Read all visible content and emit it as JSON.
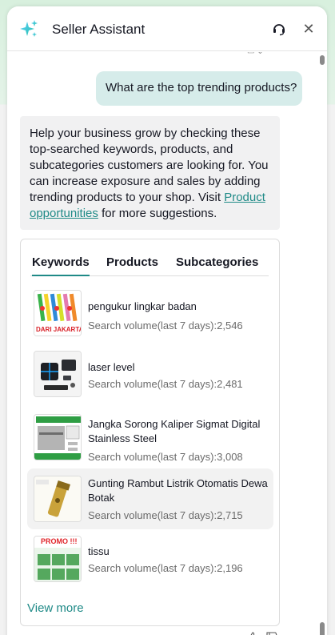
{
  "header": {
    "title": "Seller Assistant",
    "accent": "#2fb8b0"
  },
  "conversation": {
    "user_message": "What are the top trending products?",
    "bot_message_part1": "Help your business grow by checking these top-searched keywords, products, and subcategories customers are looking for. You can increase exposure and sales by adding trending products to your shop. Visit ",
    "bot_link": "Product opportunities",
    "bot_message_part2": " for more suggestions."
  },
  "card": {
    "tabs": [
      {
        "label": "Keywords",
        "active": true
      },
      {
        "label": "Products",
        "active": false
      },
      {
        "label": "Subcategories",
        "active": false
      }
    ],
    "items": [
      {
        "name": "pengukur lingkar badan",
        "volume": "Search volume(last 7 days):2,546",
        "thumb_text": "DARI JAKARTA"
      },
      {
        "name": "laser level",
        "volume": "Search volume(last 7 days):2,481"
      },
      {
        "name": "Jangka Sorong Kaliper Sigmat Digital Stainless Steel",
        "volume": "Search volume(last 7 days):3,008"
      },
      {
        "name": "Gunting Rambut Listrik Otomatis Dewa Botak",
        "volume": "Search volume(last 7 days):2,715"
      },
      {
        "name": "tissu",
        "volume": "Search volume(last 7 days):2,196",
        "thumb_text": "PROMO !!!"
      }
    ],
    "view_more": "View more"
  },
  "icons": {
    "sparkle": "sparkle-icon",
    "headset": "headset-icon",
    "close": "close-icon",
    "thumbs_up": "thumbs-up-icon",
    "thumbs_down": "thumbs-down-icon"
  },
  "colors": {
    "user_bubble": "#d6ecea",
    "bot_bubble": "#f1f1f2",
    "link": "#1f8a87"
  }
}
